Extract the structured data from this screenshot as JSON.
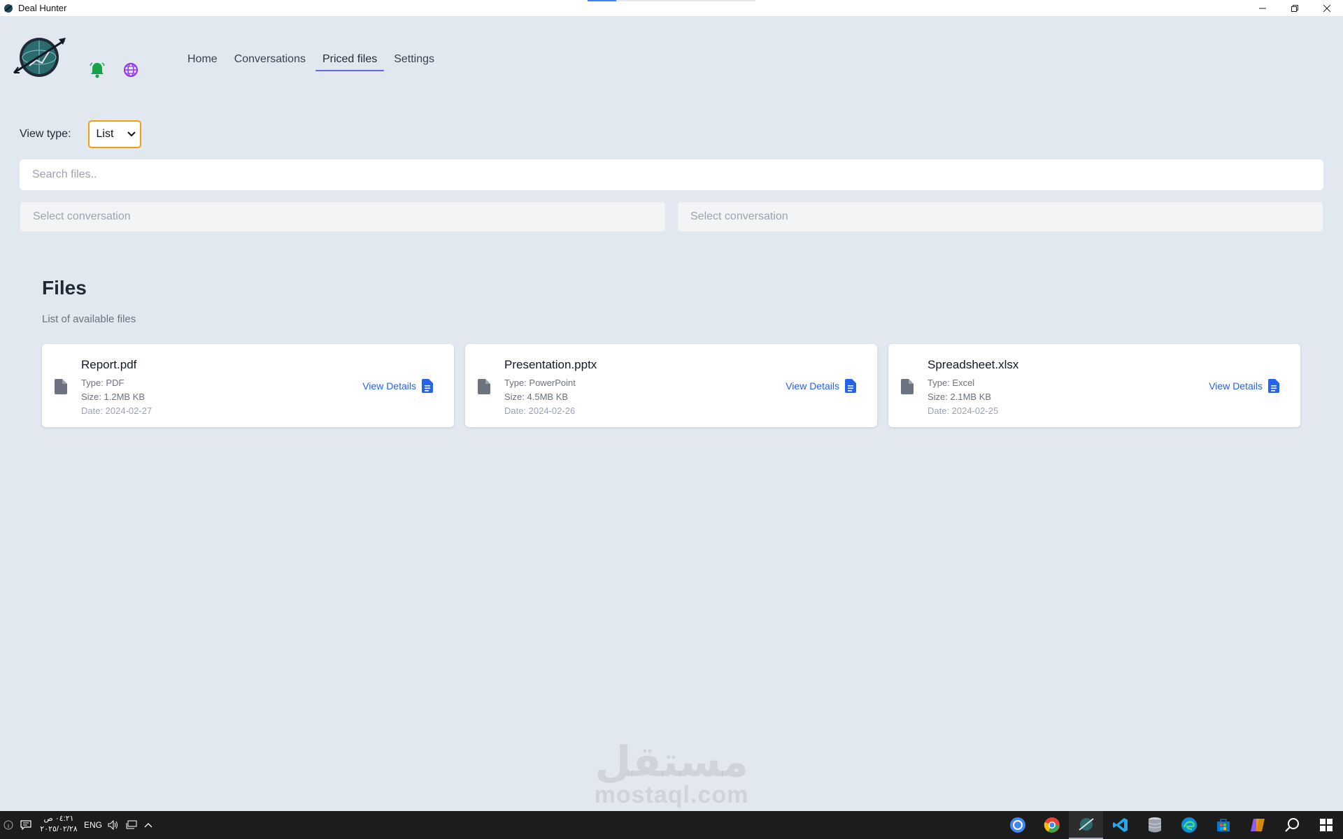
{
  "window": {
    "title": "Deal Hunter",
    "progress": 0.17
  },
  "nav": {
    "tabs": [
      {
        "label": "Home",
        "active": false
      },
      {
        "label": "Conversations",
        "active": false
      },
      {
        "label": "Priced files",
        "active": true
      },
      {
        "label": "Settings",
        "active": false
      }
    ]
  },
  "icons": {
    "bell_color": "#16a34a",
    "globe_color": "#9333ea",
    "accent": "#6366f1",
    "link_color": "#2563eb"
  },
  "controls": {
    "view_type_label": "View type:",
    "view_type_value": "List",
    "search_placeholder": "Search files..",
    "conversation_select_1": "Select conversation",
    "conversation_select_2": "Select conversation"
  },
  "files": {
    "title": "Files",
    "subtitle": "List of available files",
    "details_label": "View Details",
    "items": [
      {
        "name": "Report.pdf",
        "type": "Type: PDF",
        "size": "Size: 1.2MB KB",
        "date": "Date: 2024-02-27"
      },
      {
        "name": "Presentation.pptx",
        "type": "Type: PowerPoint",
        "size": "Size: 4.5MB KB",
        "date": "Date: 2024-02-26"
      },
      {
        "name": "Spreadsheet.xlsx",
        "type": "Type: Excel",
        "size": "Size: 2.1MB KB",
        "date": "Date: 2024-02-25"
      }
    ]
  },
  "watermark": {
    "arabic": "مستقل",
    "latin": "mostaql.com"
  },
  "taskbar": {
    "time": "٠٤:٢١ ص",
    "date": "٢٠٢٥/٠٢/٢٨",
    "language": "ENG"
  }
}
